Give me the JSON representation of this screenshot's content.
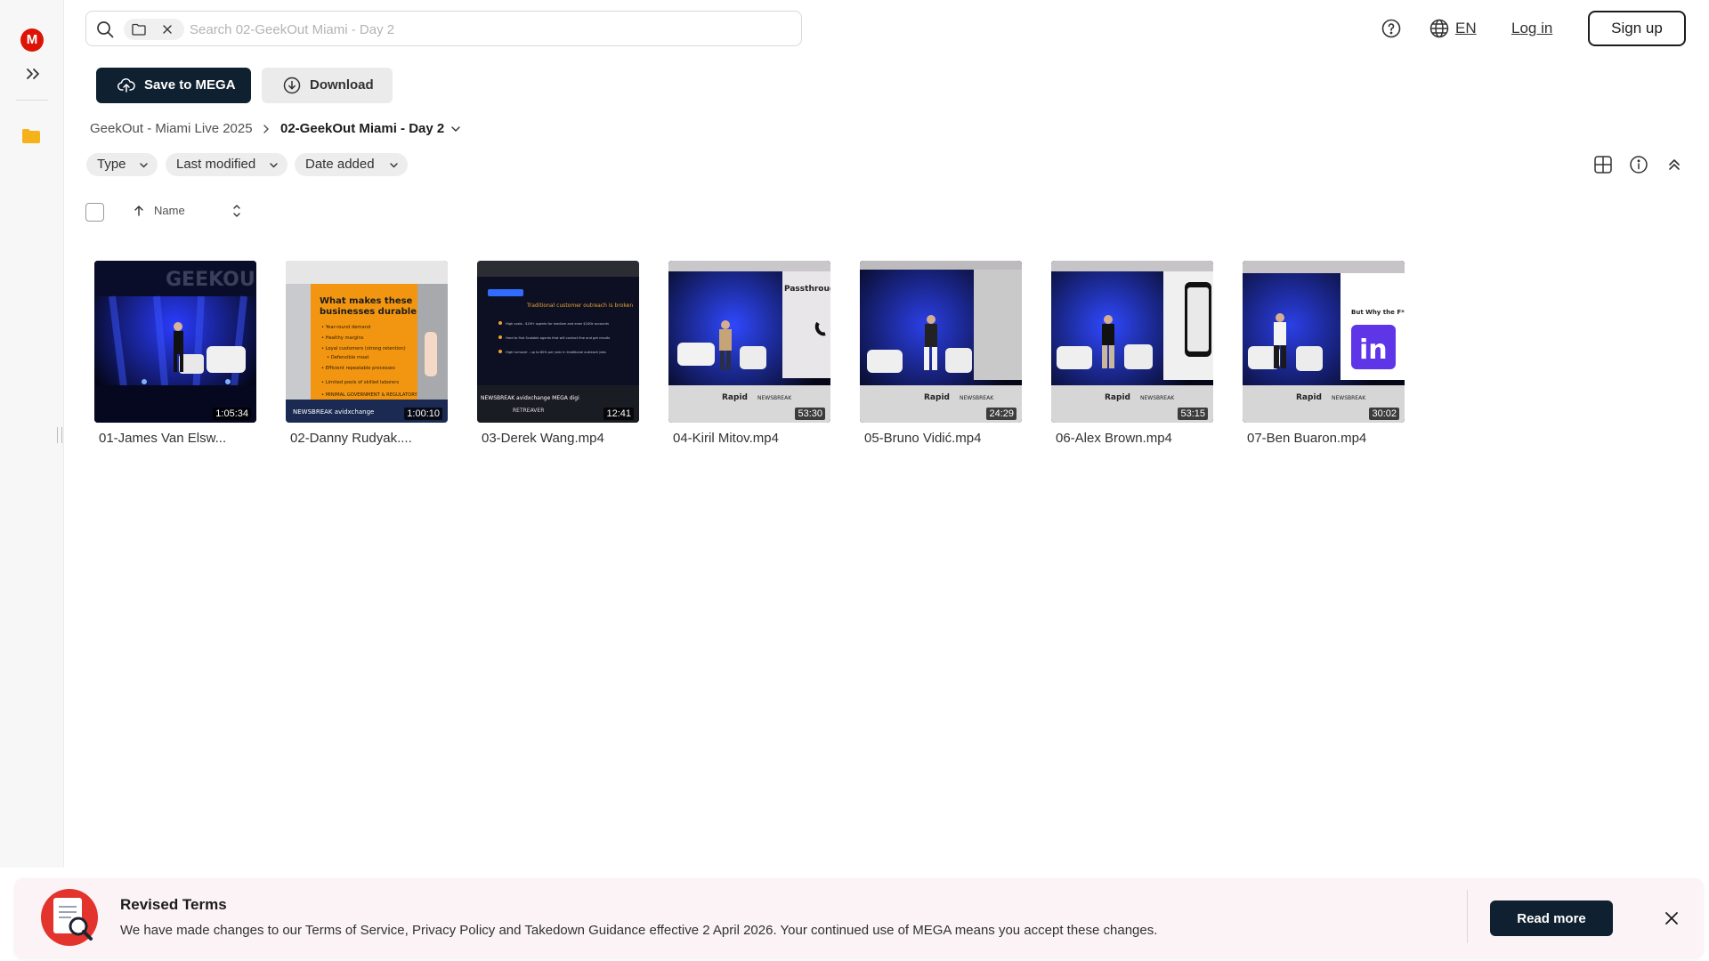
{
  "app": {
    "logo_letter": "M",
    "brand_color": "#dd1405",
    "accent_dark": "#0f2030"
  },
  "search": {
    "placeholder": "Search 02-GeekOut Miami - Day 2",
    "value": ""
  },
  "header": {
    "language": "EN",
    "login_label": "Log in",
    "signup_label": "Sign up"
  },
  "toolbar": {
    "save_label": "Save to MEGA",
    "download_label": "Download"
  },
  "breadcrumb": {
    "parent": "GeekOut - Miami Live 2025",
    "current": "02-GeekOut Miami - Day 2"
  },
  "filters": [
    {
      "label": "Type"
    },
    {
      "label": "Last modified"
    },
    {
      "label": "Date added"
    }
  ],
  "list_header": {
    "name_label": "Name"
  },
  "files": [
    {
      "name": "01-James Van Elsw...",
      "duration": "1:05:34",
      "theme": "stage-dark"
    },
    {
      "name": "02-Danny Rudyak....",
      "duration": "1:00:10",
      "theme": "slide-orange"
    },
    {
      "name": "03-Derek Wang.mp4",
      "duration": "12:41",
      "theme": "slide-dark"
    },
    {
      "name": "04-Kiril Mitov.mp4",
      "duration": "53:30",
      "theme": "stage-screen"
    },
    {
      "name": "05-Bruno Vidić.mp4",
      "duration": "24:29",
      "theme": "stage-screen"
    },
    {
      "name": "06-Alex Brown.mp4",
      "duration": "53:15",
      "theme": "stage-phone"
    },
    {
      "name": "07-Ben Buaron.mp4",
      "duration": "30:02",
      "theme": "stage-linkedin"
    }
  ],
  "thumb_text": {
    "danny_slide_heading": "What makes these businesses durable",
    "kiril_screen_text": "Passthrough",
    "ben_screen_text": "But Why the F*ck I",
    "ben_logo_text": "in",
    "stage_sponsor": "Rapid"
  },
  "banner": {
    "title": "Revised Terms",
    "text": "We have made changes to our Terms of Service, Privacy Policy and Takedown Guidance effective 2 April 2026. Your continued use of MEGA means you accept these changes.",
    "read_more_label": "Read more"
  }
}
